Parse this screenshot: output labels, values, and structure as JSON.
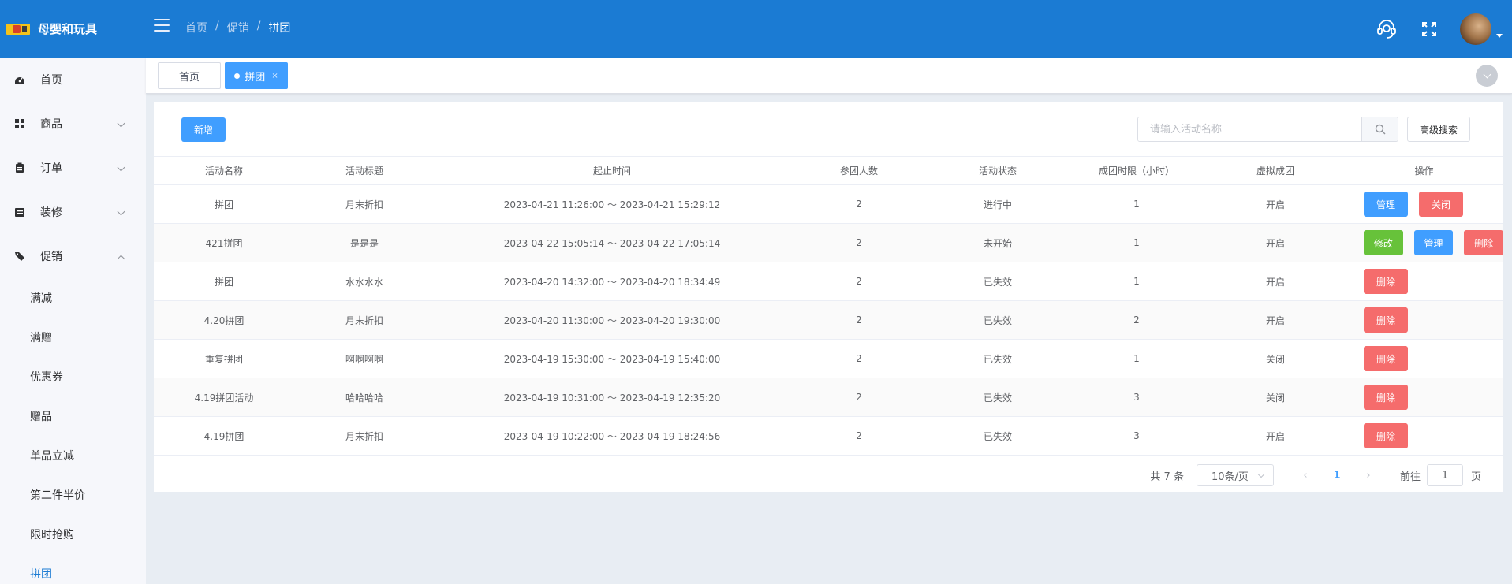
{
  "header": {
    "app_title": "母婴和玩具",
    "breadcrumb": [
      "首页",
      "促销",
      "拼团"
    ]
  },
  "sidebar": {
    "items": [
      {
        "label": "首页",
        "icon": "dashboard-icon"
      },
      {
        "label": "商品",
        "icon": "grid-icon"
      },
      {
        "label": "订单",
        "icon": "clipboard-icon"
      },
      {
        "label": "装修",
        "icon": "store-icon"
      },
      {
        "label": "促销",
        "icon": "tag-icon"
      }
    ],
    "sub_items": [
      "满减",
      "满赠",
      "优惠券",
      "赠品",
      "单品立减",
      "第二件半价",
      "限时抢购",
      "拼团"
    ]
  },
  "tabs": [
    {
      "label": "首页"
    },
    {
      "label": "拼团",
      "close": "×"
    }
  ],
  "toolbar": {
    "add_label": "新增",
    "search_placeholder": "请输入活动名称",
    "advanced_search_label": "高级搜索"
  },
  "table": {
    "columns": [
      "活动名称",
      "活动标题",
      "起止时间",
      "参团人数",
      "活动状态",
      "成团时限（小时）",
      "虚拟成团",
      "操作"
    ],
    "rows": [
      {
        "name": "拼团",
        "title": "月末折扣",
        "time": "2023-04-21 11:26:00 ～ 2023-04-21 15:29:12",
        "count": "2",
        "status": "进行中",
        "limit": "1",
        "virtual": "开启",
        "actions": [
          {
            "label": "管理",
            "type": "primary"
          },
          {
            "label": "关闭",
            "type": "danger"
          }
        ]
      },
      {
        "name": "421拼团",
        "title": "是是是",
        "time": "2023-04-22 15:05:14 ～ 2023-04-22 17:05:14",
        "count": "2",
        "status": "未开始",
        "limit": "1",
        "virtual": "开启",
        "actions": [
          {
            "label": "修改",
            "type": "success"
          },
          {
            "label": "管理",
            "type": "primary"
          },
          {
            "label": "删除",
            "type": "danger"
          }
        ]
      },
      {
        "name": "拼团",
        "title": "水水水水",
        "time": "2023-04-20 14:32:00 ～ 2023-04-20 18:34:49",
        "count": "2",
        "status": "已失效",
        "limit": "1",
        "virtual": "开启",
        "actions": [
          {
            "label": "删除",
            "type": "danger"
          }
        ]
      },
      {
        "name": "4.20拼团",
        "title": "月末折扣",
        "time": "2023-04-20 11:30:00 ～ 2023-04-20 19:30:00",
        "count": "2",
        "status": "已失效",
        "limit": "2",
        "virtual": "开启",
        "actions": [
          {
            "label": "删除",
            "type": "danger"
          }
        ]
      },
      {
        "name": "重复拼团",
        "title": "啊啊啊啊",
        "time": "2023-04-19 15:30:00 ～ 2023-04-19 15:40:00",
        "count": "2",
        "status": "已失效",
        "limit": "1",
        "virtual": "关闭",
        "actions": [
          {
            "label": "删除",
            "type": "danger"
          }
        ]
      },
      {
        "name": "4.19拼团活动",
        "title": "哈哈哈哈",
        "time": "2023-04-19 10:31:00 ～ 2023-04-19 12:35:20",
        "count": "2",
        "status": "已失效",
        "limit": "3",
        "virtual": "关闭",
        "actions": [
          {
            "label": "删除",
            "type": "danger"
          }
        ]
      },
      {
        "name": "4.19拼团",
        "title": "月末折扣",
        "time": "2023-04-19 10:22:00 ～ 2023-04-19 18:24:56",
        "count": "2",
        "status": "已失效",
        "limit": "3",
        "virtual": "开启",
        "actions": [
          {
            "label": "删除",
            "type": "danger"
          }
        ]
      }
    ]
  },
  "pagination": {
    "total": "共 7 条",
    "page_size": "10条/页",
    "prev": "‹",
    "current_page": "1",
    "next": "›",
    "goto_label": "前往",
    "goto_value": "1",
    "goto_unit": "页"
  },
  "colors": {
    "header_bg": "#1b7bd3",
    "primary": "#409eff",
    "success": "#67c23a",
    "danger": "#f56c6c"
  }
}
